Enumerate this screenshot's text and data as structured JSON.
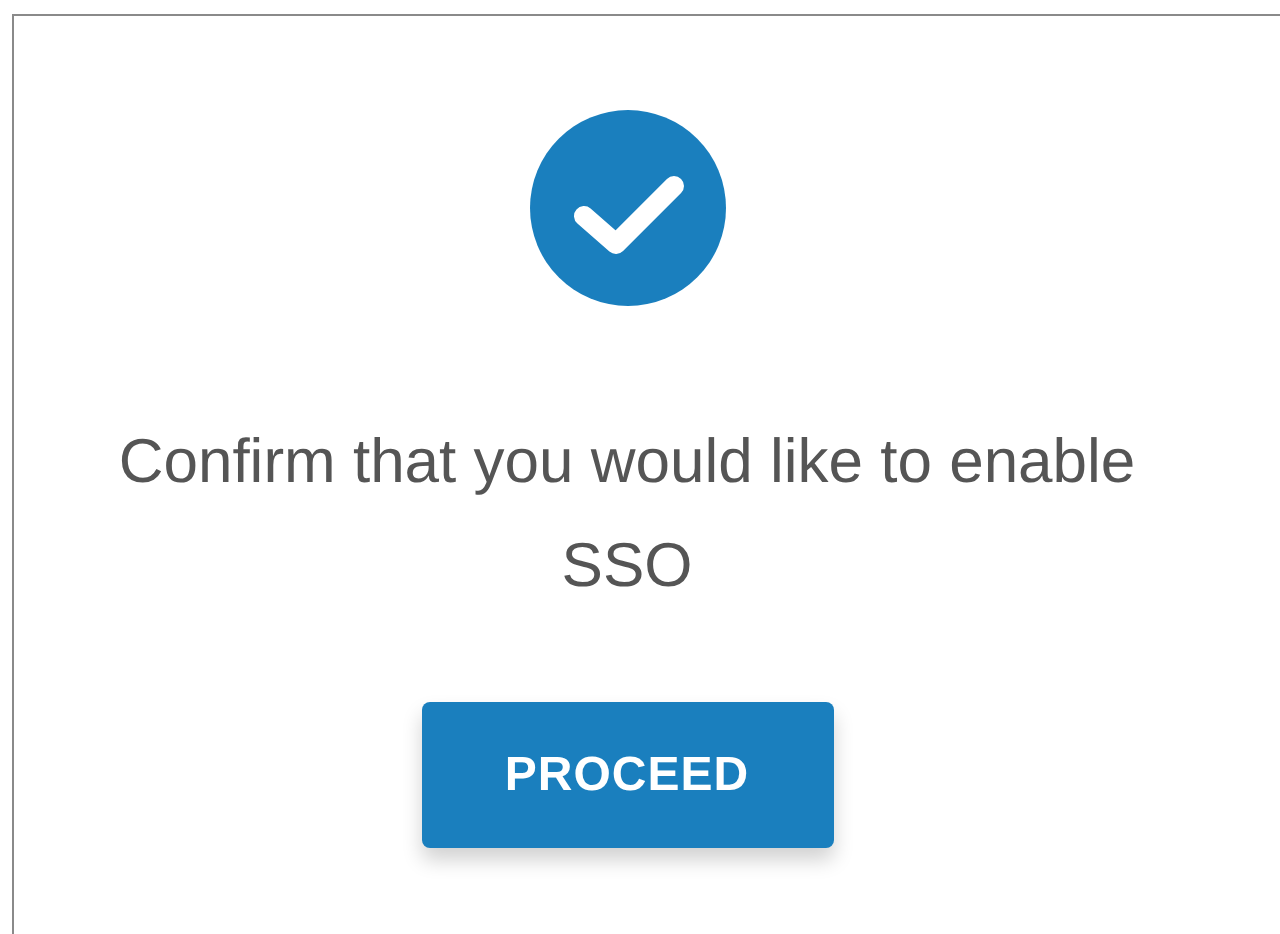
{
  "dialog": {
    "message": "Confirm that you would like to enable SSO",
    "button": "PROCEED"
  }
}
